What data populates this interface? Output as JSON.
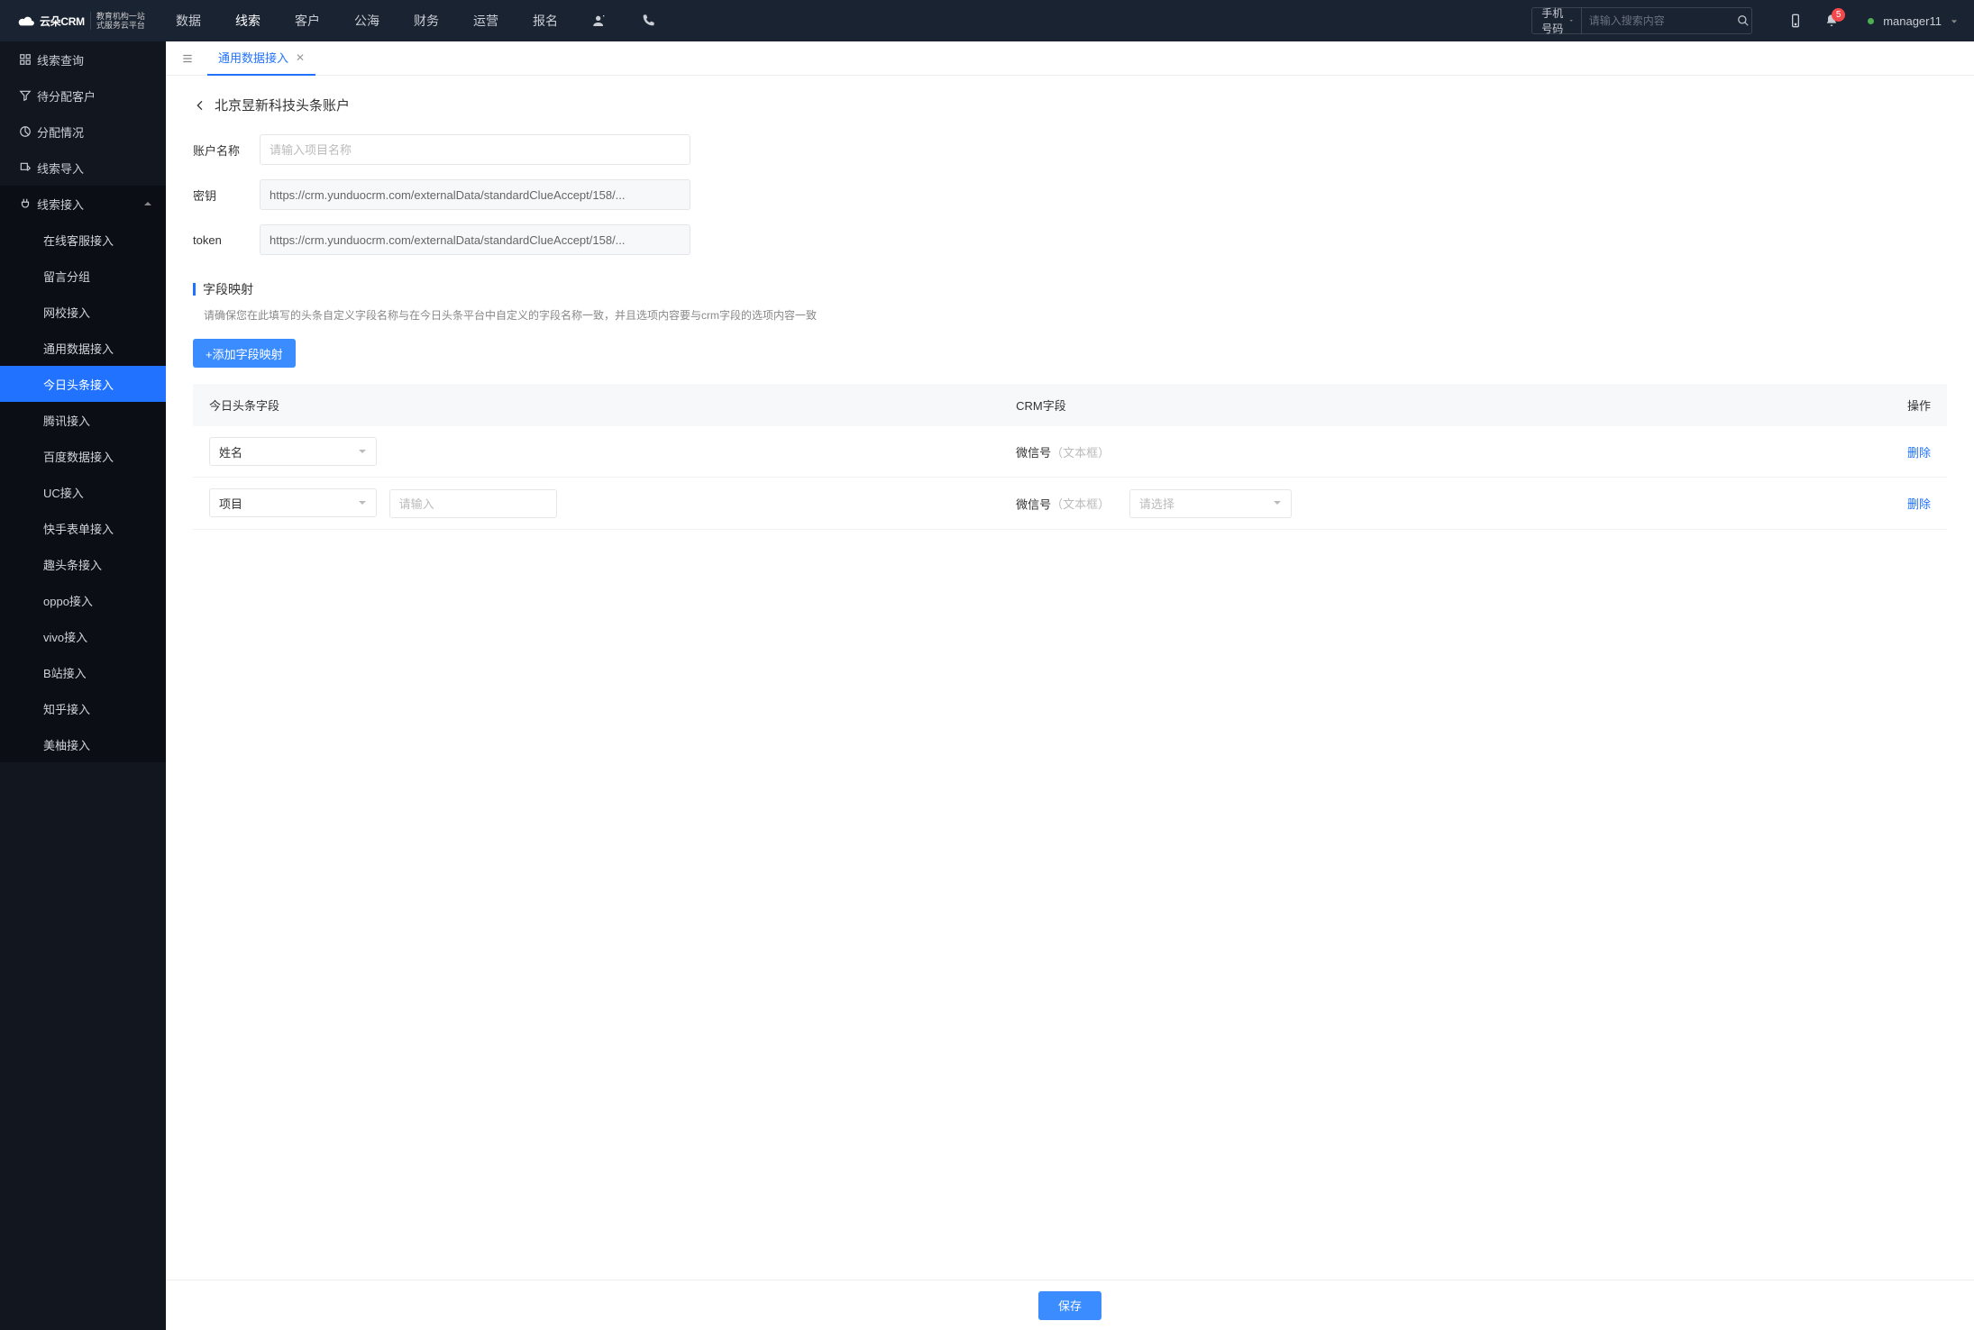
{
  "header": {
    "logo_main": "云朵CRM",
    "logo_sub_l1": "教育机构一站",
    "logo_sub_l2": "式服务云平台",
    "nav": [
      "数据",
      "线索",
      "客户",
      "公海",
      "财务",
      "运营",
      "报名"
    ],
    "nav_active_index": 1,
    "search_type": "手机号码",
    "search_placeholder": "请输入搜索内容",
    "badge_count": "5",
    "user_name": "manager11"
  },
  "sidebar": {
    "items": [
      {
        "label": "线索查询",
        "icon": "grid"
      },
      {
        "label": "待分配客户",
        "icon": "funnel"
      },
      {
        "label": "分配情况",
        "icon": "pie"
      },
      {
        "label": "线索导入",
        "icon": "export"
      },
      {
        "label": "线索接入",
        "icon": "plug",
        "expanded": true,
        "children": [
          "在线客服接入",
          "留言分组",
          "网校接入",
          "通用数据接入",
          "今日头条接入",
          "腾讯接入",
          "百度数据接入",
          "UC接入",
          "快手表单接入",
          "趣头条接入",
          "oppo接入",
          "vivo接入",
          "B站接入",
          "知乎接入",
          "美柚接入"
        ],
        "active_child_index": 4
      }
    ]
  },
  "tab": {
    "label": "通用数据接入"
  },
  "page": {
    "title": "北京昱新科技头条账户",
    "form": {
      "account_label": "账户名称",
      "account_placeholder": "请输入项目名称",
      "key_label": "密钥",
      "key_value": "https://crm.yunduocrm.com/externalData/standardClueAccept/158/...",
      "token_label": "token",
      "token_value": "https://crm.yunduocrm.com/externalData/standardClueAccept/158/..."
    },
    "mapping": {
      "title": "字段映射",
      "desc": "请确保您在此填写的头条自定义字段名称与在今日头条平台中自定义的字段名称一致，并且选项内容要与crm字段的选项内容一致",
      "add_btn": "+添加字段映射",
      "columns": [
        "今日头条字段",
        "CRM字段",
        "操作"
      ],
      "rows": [
        {
          "tt_field": "姓名",
          "crm_label": "微信号",
          "crm_note": "（文本框）",
          "action": "删除"
        },
        {
          "tt_field": "项目",
          "extra_placeholder": "请输入",
          "crm_label": "微信号",
          "crm_note": "（文本框）",
          "crm_sel_placeholder": "请选择",
          "action": "删除"
        }
      ]
    },
    "save_btn": "保存"
  }
}
